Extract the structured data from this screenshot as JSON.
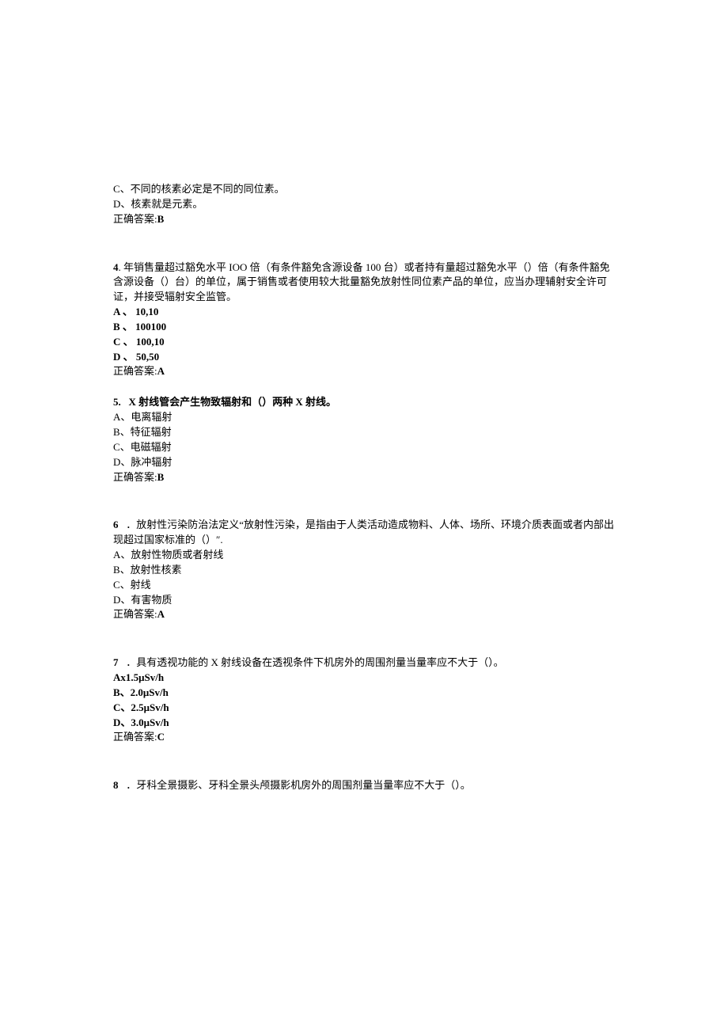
{
  "q3": {
    "optC": "C、不同的核素必定是不同的同位素。",
    "optD": "D、核素就是元素。",
    "answerLabel": "正确答案:",
    "answerVal": "B"
  },
  "q4": {
    "numLabel": "4",
    "stem": ". 年销售量超过豁免水平 IOO 倍（有条件豁免含源设备 100 台）或者持有量超过豁免水平（）倍（有条件豁免含源设备（）台）的单位，属于销售或者使用较大批量豁免放射性同位素产品的单位，应当办理辅射安全许可证，并接受辐射安全监管。",
    "optA": "A 、  10,10",
    "optB": "B 、  100100",
    "optC": "C 、  100,10",
    "optD": "D 、  50,50",
    "answerLabel": "正确答案:",
    "answerVal": "A"
  },
  "q5": {
    "numLabel": "5.",
    "stem": "X 射线管会产生物致辐射和（）两种 X 射线。",
    "optA": "A、电离辐射",
    "optB": "B、特征辐射",
    "optC": "C、电磁辐射",
    "optD": "D、脉冲辐射",
    "answerLabel": "正确答案:",
    "answerVal": "B"
  },
  "q6": {
    "numLabel": "6",
    "stem": "．放射性污染防治法定义“放射性污染，是指由于人类活动造成物料、人体、场所、环境介质表面或者内部出现超过国家标准的（）″.",
    "optA": "A、放射性物质或者射线",
    "optB": "B、放射性核素",
    "optC": "C、射线",
    "optD": "D、有害物质",
    "answerLabel": "正确答案:",
    "answerVal": "A"
  },
  "q7": {
    "numLabel": "7",
    "stem": "．具有透视功能的 X 射线设备在透视条件下机房外的周围剂量当量率应不大于（）。",
    "optA": "Ax1.5μSv/h",
    "optB": "B、2.0μSv/h",
    "optC": "C、2.5μSv/h",
    "optD": "D、3.0μSv/h",
    "answerLabel": "正确答案:",
    "answerVal": "C"
  },
  "q8": {
    "numLabel": "8",
    "stem": "．牙科全景摄影、牙科全景头颅摄影机房外的周围剂量当量率应不大于（）。"
  }
}
